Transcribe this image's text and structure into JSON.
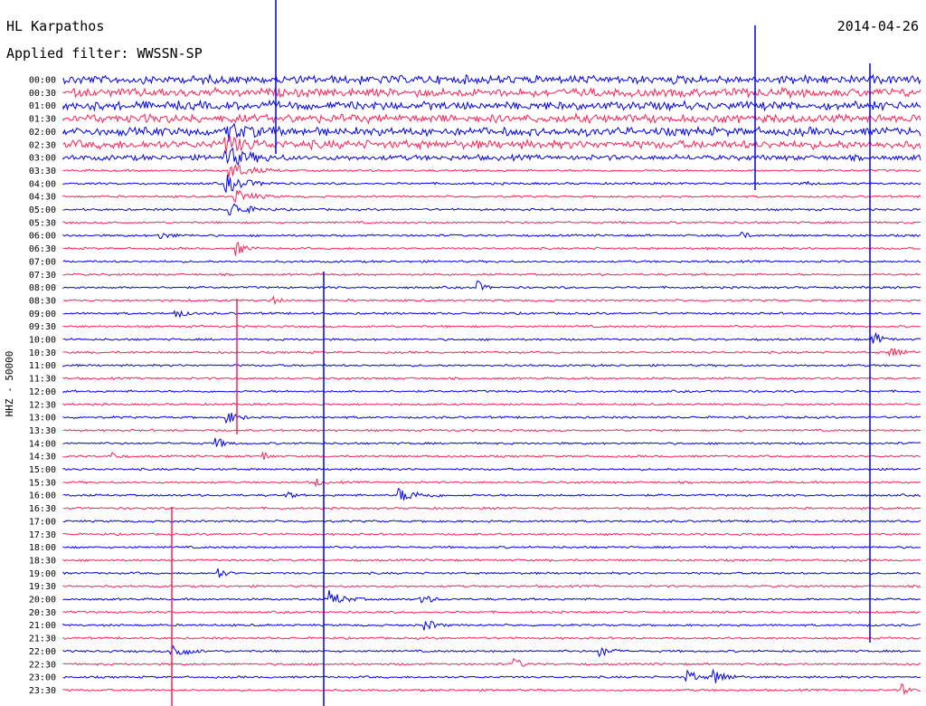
{
  "header": {
    "station": "HL Karpathos",
    "date": "2014-04-26",
    "filter": "Applied filter: WWSSN-SP"
  },
  "colors": {
    "trace_a": "#0000ee",
    "trace_b": "#ff2255",
    "text": "#000000",
    "background": "#ffffff"
  },
  "chart_data": {
    "type": "line",
    "title": "HL Karpathos",
    "subtitle": "Applied filter: WWSSN-SP",
    "ylabel": "HHZ - 50000",
    "xlabel": "",
    "row_labels": [
      "00:00",
      "00:30",
      "01:00",
      "01:30",
      "02:00",
      "02:30",
      "03:00",
      "03:30",
      "04:00",
      "04:30",
      "05:00",
      "05:30",
      "06:00",
      "06:30",
      "07:00",
      "07:30",
      "08:00",
      "08:30",
      "09:00",
      "09:30",
      "10:00",
      "10:30",
      "11:00",
      "11:30",
      "12:00",
      "12:30",
      "13:00",
      "13:30",
      "14:00",
      "14:30",
      "15:00",
      "15:30",
      "16:00",
      "16:30",
      "17:00",
      "17:30",
      "18:00",
      "18:30",
      "19:00",
      "19:30",
      "20:00",
      "20:30",
      "21:00",
      "21:30",
      "22:00",
      "22:30",
      "23:00",
      "23:30"
    ],
    "row_colors": [
      "trace_a",
      "trace_b"
    ],
    "grid": false,
    "legend": "none"
  }
}
